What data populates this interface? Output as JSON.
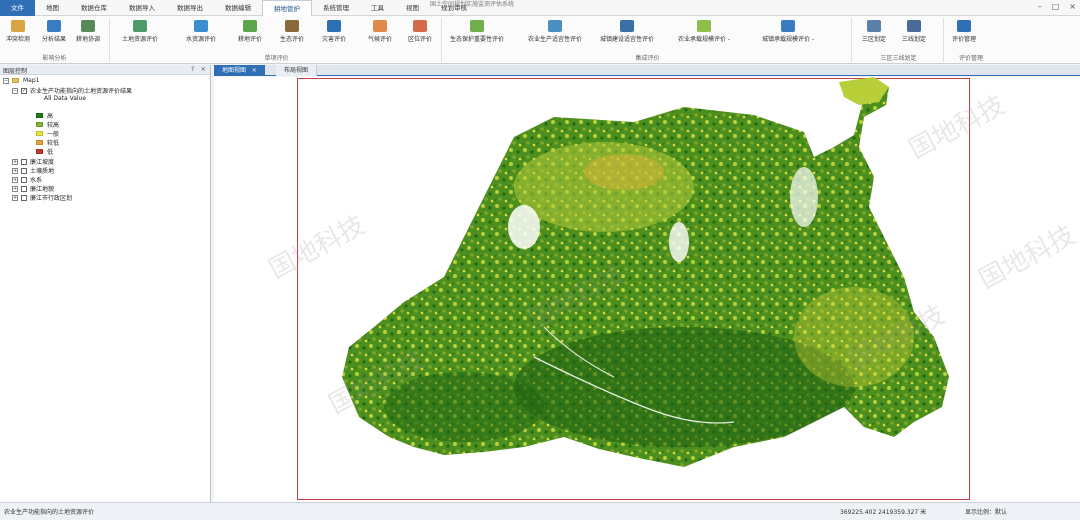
{
  "window": {
    "title": "国土空间规划实施监测评估系统",
    "controls": [
      "minimize",
      "maximize",
      "close"
    ]
  },
  "menu": {
    "items": [
      "文件",
      "地图",
      "数据仓库",
      "数据导入",
      "数据导出",
      "数据编辑",
      "耕地管护",
      "系统管理",
      "工具",
      "视图",
      "规划审核"
    ]
  },
  "ribbon": {
    "groups": [
      {
        "title": "影响分析",
        "buttons": [
          "冲突检测",
          "分析结果",
          "耕地协调"
        ]
      },
      {
        "title": "",
        "buttons": [
          "土地资源评价",
          "水资源评价",
          "耕地评价",
          "生态评价",
          "灾害评价",
          "气候评价",
          "区位评价"
        ]
      },
      {
        "title": "单项评价",
        "buttons": []
      },
      {
        "title": "集成评价",
        "buttons": [
          "生态保护重要性评价",
          "农业生产适宜性评价",
          "城镇建设适宜性评价",
          "农业承载规模评价 -",
          "城镇承载规模评价 -"
        ]
      },
      {
        "title": "三区三线划定",
        "buttons": [
          "三区划定",
          "三线划定"
        ]
      },
      {
        "title": "评价管理",
        "buttons": [
          "评价管理"
        ]
      }
    ]
  },
  "left_panel": {
    "title": "图层控制",
    "controls": [
      "?",
      "×"
    ],
    "tree": {
      "root": "Map1",
      "layer": "农业生产功能指向的土地资源评价结果",
      "sublabel": "All Data Value",
      "legend": [
        {
          "label": "高",
          "color": "#1f7a1f"
        },
        {
          "label": "较高",
          "color": "#7fb63a"
        },
        {
          "label": "一般",
          "color": "#e8e53a"
        },
        {
          "label": "较低",
          "color": "#e8a13a"
        },
        {
          "label": "低",
          "color": "#c0392b"
        }
      ],
      "other_layers": [
        "廉江坡度",
        "土壤质地",
        "水系",
        "廉江地貌",
        "廉江市行政区划"
      ]
    }
  },
  "tabs": {
    "active": "地图视图",
    "inactive": "布局视图",
    "close_glyph": "×"
  },
  "map": {
    "watermark": "国地科技"
  },
  "status": {
    "left": "农业生产功能指向的土地资源评价",
    "coords": "369225.402  2419359.327 米",
    "scale": "显示比例：默认"
  }
}
